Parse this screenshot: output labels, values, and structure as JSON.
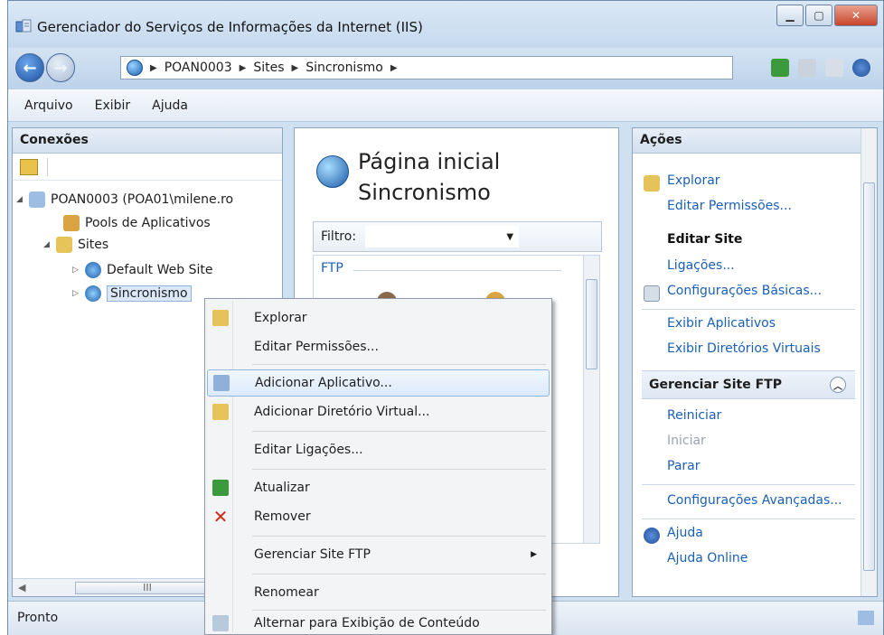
{
  "window": {
    "title": "Gerenciador do Serviços de Informações da Internet (IIS)"
  },
  "address": {
    "crumbs": [
      "POAN0003",
      "Sites",
      "Sincronismo"
    ]
  },
  "menu": [
    "Arquivo",
    "Exibir",
    "Ajuda"
  ],
  "connections": {
    "title": "Conexões",
    "tree": [
      {
        "label": "POAN0003 (POA01\\milene.ro",
        "icon": "server-icon"
      },
      {
        "label": "Pools de Aplicativos",
        "icon": "app-pool-icon"
      },
      {
        "label": "Sites",
        "icon": "folder-icon"
      },
      {
        "label": "Default Web Site",
        "icon": "website-icon"
      },
      {
        "label": "Sincronismo",
        "icon": "globe-icon"
      }
    ]
  },
  "home": {
    "title_line1": "Página inicial",
    "title_line2": "Sincronismo",
    "filter_label": "Filtro:",
    "section_label": "FTP"
  },
  "actions": {
    "title": "Ações",
    "explore": "Explorar",
    "edit_permissions": "Editar Permissões...",
    "edit_site_header": "Editar Site",
    "bindings": "Ligações...",
    "basic_settings": "Configurações Básicas...",
    "view_apps": "Exibir Aplicativos",
    "view_vdirs": "Exibir Diretórios Virtuais",
    "manage_ftp_header": "Gerenciar Site FTP",
    "restart": "Reiniciar",
    "start": "Iniciar",
    "stop": "Parar",
    "advanced_settings": "Configurações Avançadas...",
    "help": "Ajuda",
    "online_help": "Ajuda Online"
  },
  "context_menu": {
    "explore": "Explorar",
    "edit_permissions": "Editar Permissões...",
    "add_application": "Adicionar Aplicativo...",
    "add_virtual_directory": "Adicionar Diretório Virtual...",
    "edit_bindings": "Editar Ligações...",
    "refresh": "Atualizar",
    "remove": "Remover",
    "manage_ftp_site": "Gerenciar Site FTP",
    "rename": "Renomear",
    "switch_content_view": "Alternar para Exibição de Conteúdo"
  },
  "status": {
    "text": "Pronto"
  },
  "colors": {
    "link": "#1a5fb8",
    "highlight": "#dbeafb",
    "remove": "#d32a1e"
  }
}
